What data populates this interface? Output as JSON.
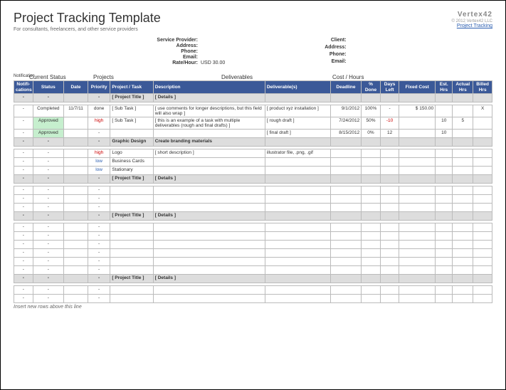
{
  "header": {
    "title": "Project Tracking Template",
    "subtitle": "For consultants, freelancers, and other service providers",
    "logo": "Vertex42",
    "copyright": "© 2012 Vertex42 LLC",
    "link": "Project Tracking"
  },
  "provider": {
    "label_sp": "Service Provider:",
    "label_addr": "Address:",
    "label_phone": "Phone:",
    "label_email": "Email:",
    "label_rate": "Rate/Hour:",
    "rate": "USD 30.00"
  },
  "client": {
    "label_client": "Client:",
    "label_addr": "Address:",
    "label_phone": "Phone:",
    "label_email": "Email:"
  },
  "sections": {
    "notif": "Notification",
    "status": "Current Status",
    "projects": "Projects",
    "deliv": "Deliverables",
    "cost": "Cost / Hours"
  },
  "columns": {
    "notif": "Notifi-cations",
    "status": "Status",
    "date": "Date",
    "priority": "Priority",
    "task": "Project / Task",
    "desc": "Description",
    "deliv": "Deliverable(s)",
    "deadline": "Deadline",
    "pct": "% Done",
    "days": "Days Left",
    "fixed": "Fixed Cost",
    "est": "Est. Hrs",
    "act": "Actual Hrs",
    "bill": "Billed Hrs"
  },
  "rows": [
    {
      "type": "gray",
      "notif": "-",
      "status": "-",
      "date": "",
      "priority": "-",
      "task": "[ Project Title ]",
      "desc": "[ Details ]"
    },
    {
      "type": "empty"
    },
    {
      "type": "data",
      "notif": "-",
      "status": "Completed",
      "date": "11/7/11",
      "priority": "done",
      "task": "[ Sub Task ]",
      "desc": "[ use comments for longer descriptions, but this field will also wrap ]",
      "deliv": "[ product xyz installation ]",
      "deadline": "9/1/2012",
      "pct": "100%",
      "days": "-",
      "fixed": "$     150.00",
      "est": "",
      "act": "",
      "bill": "X"
    },
    {
      "type": "data",
      "notif": "-",
      "status": "Approved",
      "status_class": "status-approved",
      "date": "",
      "priority": "high",
      "priority_class": "priority-high",
      "task": "[ Sub Task ]",
      "desc": "[ this is an example of a task with multiple deliverables (rough and final drafts) ]",
      "deliv": "[ rough draft ]",
      "deadline": "7/24/2012",
      "pct": "50%",
      "days": "-10",
      "days_class": "neg",
      "fixed": "",
      "est": "10",
      "act": "5",
      "bill": ""
    },
    {
      "type": "data",
      "notif": "-",
      "status": "Approved",
      "status_class": "status-approved",
      "date": "",
      "priority": "-",
      "task": "",
      "desc": "",
      "deliv": "[ final draft ]",
      "deadline": "8/15/2012",
      "pct": "0%",
      "days": "12",
      "fixed": "",
      "est": "10",
      "act": "",
      "bill": ""
    },
    {
      "type": "gray",
      "notif": "-",
      "status": "-",
      "date": "",
      "priority": "-",
      "task": "Graphic Design",
      "desc": "Create branding materials"
    },
    {
      "type": "empty"
    },
    {
      "type": "data",
      "notif": "-",
      "status": "-",
      "date": "",
      "priority": "high",
      "priority_class": "priority-high",
      "task": "Logo",
      "desc": "[ short description ]",
      "deliv": "illustrator file, .png, .gif",
      "deadline": "",
      "pct": "",
      "days": "",
      "fixed": "",
      "est": "",
      "act": "",
      "bill": ""
    },
    {
      "type": "data",
      "notif": "-",
      "status": "-",
      "date": "",
      "priority": "low",
      "priority_class": "priority-low",
      "task": "Business Cards",
      "desc": "",
      "deliv": "",
      "deadline": "",
      "pct": "",
      "days": "",
      "fixed": "",
      "est": "",
      "act": "",
      "bill": ""
    },
    {
      "type": "data",
      "notif": "-",
      "status": "-",
      "date": "",
      "priority": "low",
      "priority_class": "priority-low",
      "task": "Stationary",
      "desc": "",
      "deliv": "",
      "deadline": "",
      "pct": "",
      "days": "",
      "fixed": "",
      "est": "",
      "act": "",
      "bill": ""
    },
    {
      "type": "gray",
      "notif": "-",
      "status": "-",
      "date": "",
      "priority": "-",
      "task": "[ Project Title ]",
      "desc": "[ Details ]"
    },
    {
      "type": "empty"
    },
    {
      "type": "blank",
      "notif": "-",
      "status": "-",
      "priority": "-"
    },
    {
      "type": "blank",
      "notif": "-",
      "status": "-",
      "priority": "-"
    },
    {
      "type": "blank",
      "notif": "-",
      "status": "-",
      "priority": "-"
    },
    {
      "type": "gray",
      "notif": "-",
      "status": "-",
      "date": "",
      "priority": "-",
      "task": "[ Project Title ]",
      "desc": "[ Details ]"
    },
    {
      "type": "empty"
    },
    {
      "type": "blank",
      "notif": "-",
      "status": "-",
      "priority": "-"
    },
    {
      "type": "blank",
      "notif": "-",
      "status": "-",
      "priority": "-"
    },
    {
      "type": "blank",
      "notif": "-",
      "status": "-",
      "priority": "-"
    },
    {
      "type": "blank",
      "notif": "-",
      "status": "-",
      "priority": "-"
    },
    {
      "type": "blank",
      "notif": "-",
      "status": "-",
      "priority": "-"
    },
    {
      "type": "blank",
      "notif": "-",
      "status": "-",
      "priority": "-"
    },
    {
      "type": "gray",
      "notif": "-",
      "status": "-",
      "date": "",
      "priority": "-",
      "task": "[ Project Title ]",
      "desc": "[ Details ]"
    },
    {
      "type": "empty"
    },
    {
      "type": "blank",
      "notif": "-",
      "status": "-",
      "priority": "-"
    },
    {
      "type": "blank",
      "notif": "-",
      "status": "-",
      "priority": "-"
    }
  ],
  "footer": "Insert new rows above this line"
}
